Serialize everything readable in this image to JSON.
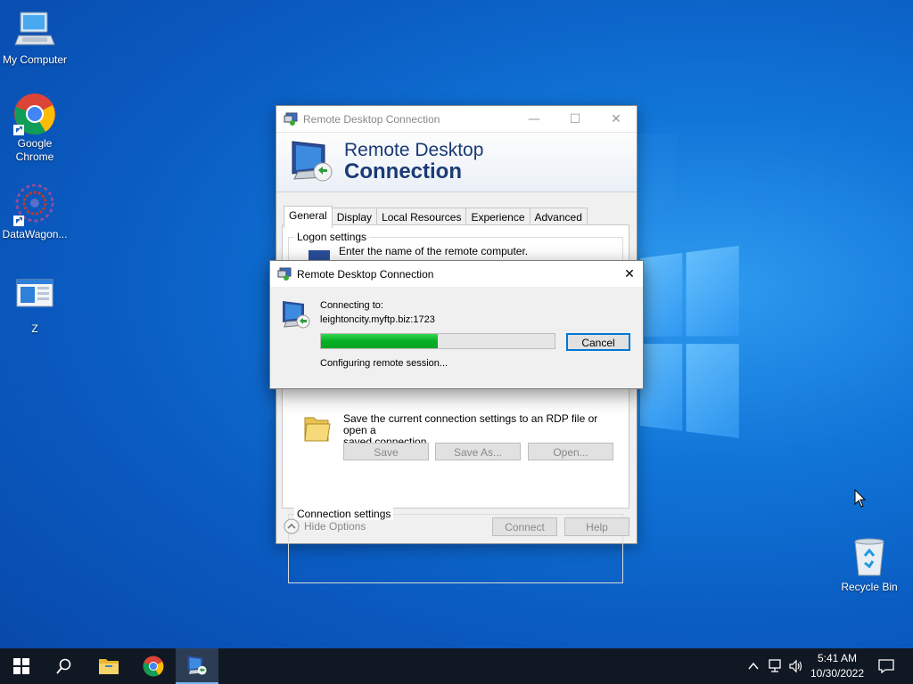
{
  "desktop": {
    "icons": [
      {
        "label": "My Computer",
        "icon": "computer-icon"
      },
      {
        "label": "Google Chrome",
        "icon": "chrome-icon"
      },
      {
        "label": "DataWagon...",
        "icon": "datawagon-icon"
      },
      {
        "label": "Z",
        "icon": "window-icon"
      },
      {
        "label": "Recycle Bin",
        "icon": "recycle-bin-icon"
      }
    ]
  },
  "rdc_window": {
    "title": "Remote Desktop Connection",
    "banner_line1": "Remote Desktop",
    "banner_line2": "Connection",
    "tabs": [
      "General",
      "Display",
      "Local Resources",
      "Experience",
      "Advanced"
    ],
    "active_tab": "General",
    "logon_settings": {
      "title": "Logon settings",
      "text": "Enter the name of the remote computer."
    },
    "connection_settings": {
      "title": "Connection settings",
      "text_line1": "Save the current connection settings to an RDP file or open a",
      "text_line2": "saved connection.",
      "buttons": [
        "Save",
        "Save As...",
        "Open..."
      ]
    },
    "hide_options": "Hide Options",
    "connect_label": "Connect",
    "help_label": "Help"
  },
  "connecting_dialog": {
    "title": "Remote Desktop Connection",
    "connecting_to_label": "Connecting to:",
    "host": "leightoncity.myftp.biz:1723",
    "progress": 0.5,
    "status": "Configuring remote session...",
    "cancel_label": "Cancel"
  },
  "taskbar": {
    "items": [
      "start-icon",
      "search-icon",
      "file-explorer-icon",
      "chrome-icon",
      "remote-desktop-icon"
    ],
    "active_item": "remote-desktop-icon",
    "clock_time": "5:41 AM",
    "clock_date": "10/30/2022"
  },
  "colors": {
    "progress_fill": "#06b025",
    "accent": "#0078d7",
    "banner_text": "#1a3a75"
  }
}
